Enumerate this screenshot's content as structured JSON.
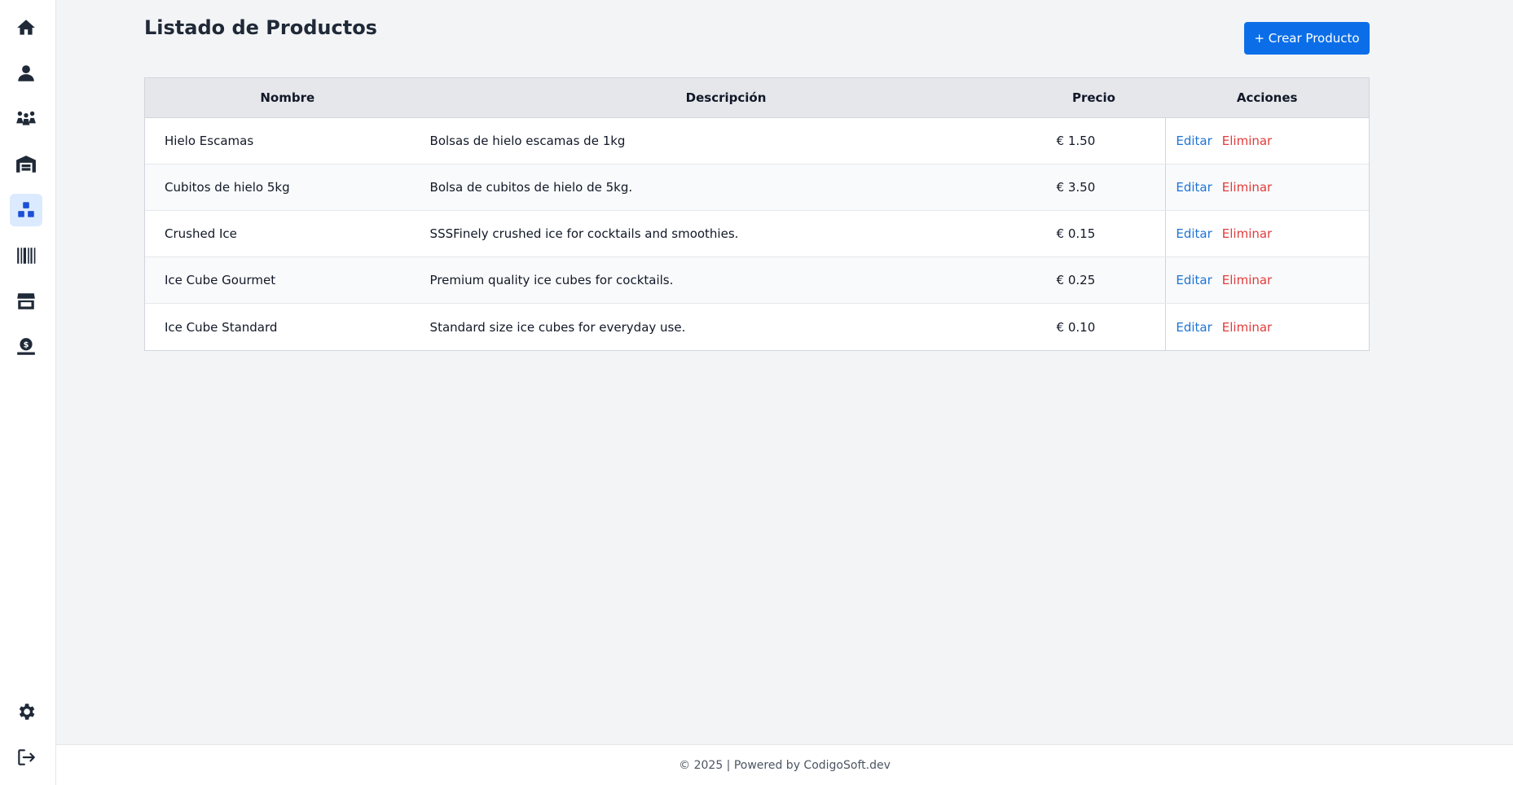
{
  "sidebar": {
    "items": [
      {
        "icon": "home-icon",
        "active": false
      },
      {
        "icon": "user-icon",
        "active": false
      },
      {
        "icon": "users-group-icon",
        "active": false
      },
      {
        "icon": "warehouse-icon",
        "active": false
      },
      {
        "icon": "boxes-icon",
        "active": true
      },
      {
        "icon": "barcode-icon",
        "active": false
      },
      {
        "icon": "store-icon",
        "active": false
      },
      {
        "icon": "money-hand-icon",
        "active": false
      }
    ],
    "bottom_items": [
      {
        "icon": "gear-icon"
      },
      {
        "icon": "logout-icon"
      }
    ]
  },
  "header": {
    "title": "Listado de Productos",
    "create_button_label": "+ Crear Producto"
  },
  "table": {
    "columns": [
      "Nombre",
      "Descripción",
      "Precio",
      "Acciones"
    ],
    "rows": [
      {
        "name": "Hielo Escamas",
        "description": "Bolsas de hielo escamas de 1kg",
        "price": "€ 1.50",
        "edit": "Editar",
        "delete": "Eliminar"
      },
      {
        "name": "Cubitos de hielo 5kg",
        "description": "Bolsa de cubitos de hielo de 5kg.",
        "price": "€ 3.50",
        "edit": "Editar",
        "delete": "Eliminar"
      },
      {
        "name": "Crushed Ice",
        "description": "SSSFinely crushed ice for cocktails and smoothies.",
        "price": "€ 0.15",
        "edit": "Editar",
        "delete": "Eliminar"
      },
      {
        "name": "Ice Cube Gourmet",
        "description": "Premium quality ice cubes for cocktails.",
        "price": "€ 0.25",
        "edit": "Editar",
        "delete": "Eliminar"
      },
      {
        "name": "Ice Cube Standard",
        "description": "Standard size ice cubes for everyday use.",
        "price": "€ 0.10",
        "edit": "Editar",
        "delete": "Eliminar"
      }
    ]
  },
  "footer": {
    "text": "© 2025 | Powered by CodigoSoft.dev"
  },
  "colors": {
    "accent": "#0b6ee8",
    "edit_link": "#1d74d6",
    "delete_link": "#e23b3b",
    "active_nav_bg": "#dbeafe"
  }
}
